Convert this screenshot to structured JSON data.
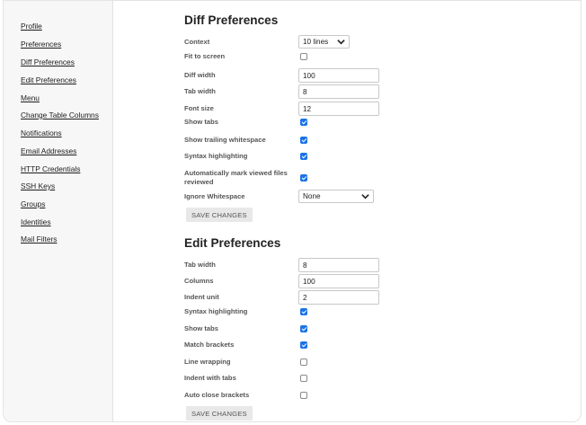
{
  "sidebar": {
    "items": [
      {
        "label": "Profile"
      },
      {
        "label": "Preferences"
      },
      {
        "label": "Diff Preferences"
      },
      {
        "label": "Edit Preferences"
      },
      {
        "label": "Menu"
      },
      {
        "label": "Change Table Columns"
      },
      {
        "label": "Notifications"
      },
      {
        "label": "Email Addresses"
      },
      {
        "label": "HTTP Credentials"
      },
      {
        "label": "SSH Keys"
      },
      {
        "label": "Groups"
      },
      {
        "label": "Identities"
      },
      {
        "label": "Mail Filters"
      }
    ]
  },
  "diff": {
    "title": "Diff Preferences",
    "context_label": "Context",
    "context_value": "10 lines",
    "fit_to_screen_label": "Fit to screen",
    "fit_to_screen": false,
    "diff_width_label": "Diff width",
    "diff_width": "100",
    "tab_width_label": "Tab width",
    "tab_width": "8",
    "font_size_label": "Font size",
    "font_size": "12",
    "show_tabs_label": "Show tabs",
    "show_tabs": true,
    "show_trailing_label": "Show trailing whitespace",
    "show_trailing": true,
    "syntax_label": "Syntax highlighting",
    "syntax": true,
    "auto_mark_label": "Automatically mark viewed files reviewed",
    "auto_mark": true,
    "ignore_ws_label": "Ignore Whitespace",
    "ignore_ws_value": "None",
    "save_label": "SAVE CHANGES"
  },
  "edit": {
    "title": "Edit Preferences",
    "tab_width_label": "Tab width",
    "tab_width": "8",
    "columns_label": "Columns",
    "columns": "100",
    "indent_unit_label": "Indent unit",
    "indent_unit": "2",
    "syntax_label": "Syntax highlighting",
    "syntax": true,
    "show_tabs_label": "Show tabs",
    "show_tabs": true,
    "match_brackets_label": "Match brackets",
    "match_brackets": true,
    "line_wrapping_label": "Line wrapping",
    "line_wrapping": false,
    "indent_tabs_label": "Indent with tabs",
    "indent_tabs": false,
    "auto_close_label": "Auto close brackets",
    "auto_close": false,
    "save_label": "SAVE CHANGES"
  },
  "colors": {
    "accent": "#1a73e8",
    "sidebar_bg": "#f7f7f7",
    "button_bg": "#e8e8e8"
  }
}
